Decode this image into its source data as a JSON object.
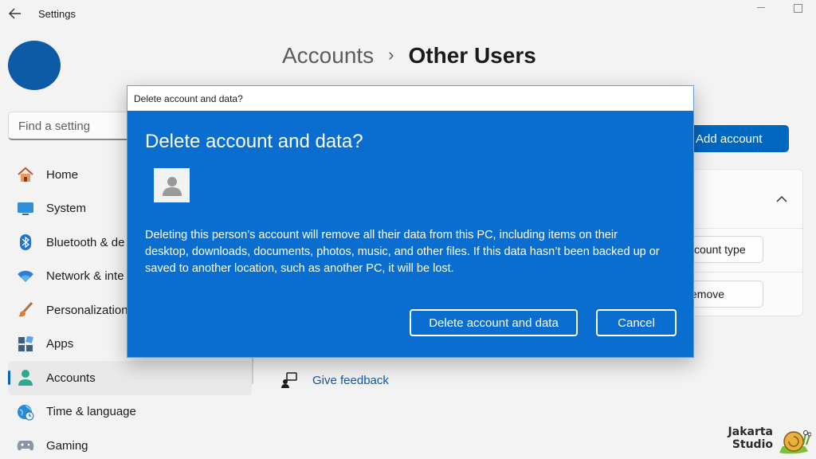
{
  "window": {
    "title": "Settings",
    "controls": [
      "minimize",
      "maximize"
    ]
  },
  "sidebar": {
    "search_placeholder": "Find a setting",
    "items": [
      {
        "label": "Home",
        "icon": "home-icon"
      },
      {
        "label": "System",
        "icon": "monitor-icon"
      },
      {
        "label": "Bluetooth & de",
        "icon": "bluetooth-icon"
      },
      {
        "label": "Network & inte",
        "icon": "wifi-icon"
      },
      {
        "label": "Personalization",
        "icon": "brush-icon"
      },
      {
        "label": "Apps",
        "icon": "apps-icon"
      },
      {
        "label": "Accounts",
        "icon": "person-icon",
        "active": true
      },
      {
        "label": "Time & language",
        "icon": "globe-clock-icon"
      },
      {
        "label": "Gaming",
        "icon": "controller-icon"
      }
    ]
  },
  "main": {
    "breadcrumb_parent": "Accounts",
    "breadcrumb_separator": "›",
    "breadcrumb_current": "Other Users",
    "add_account_label": "Add account",
    "change_type_label": "count type",
    "remove_label": "emove",
    "feedback_label": "Give feedback"
  },
  "dialog": {
    "window_title": "Delete account and data?",
    "heading": "Delete account and data?",
    "message": "Deleting this person’s account will remove all their data from this PC, including items on their desktop, downloads, documents, photos, music, and other files. If this data hasn’t been backed up or saved to another location, such as another PC, it will be lost.",
    "confirm_label": "Delete account and data",
    "cancel_label": "Cancel"
  },
  "watermark": {
    "line1": "Jakarta",
    "line2": "Studio"
  },
  "colors": {
    "accent": "#0067c0",
    "dialog_bg": "#0a6ed1",
    "avatar": "#0d5aa7"
  }
}
